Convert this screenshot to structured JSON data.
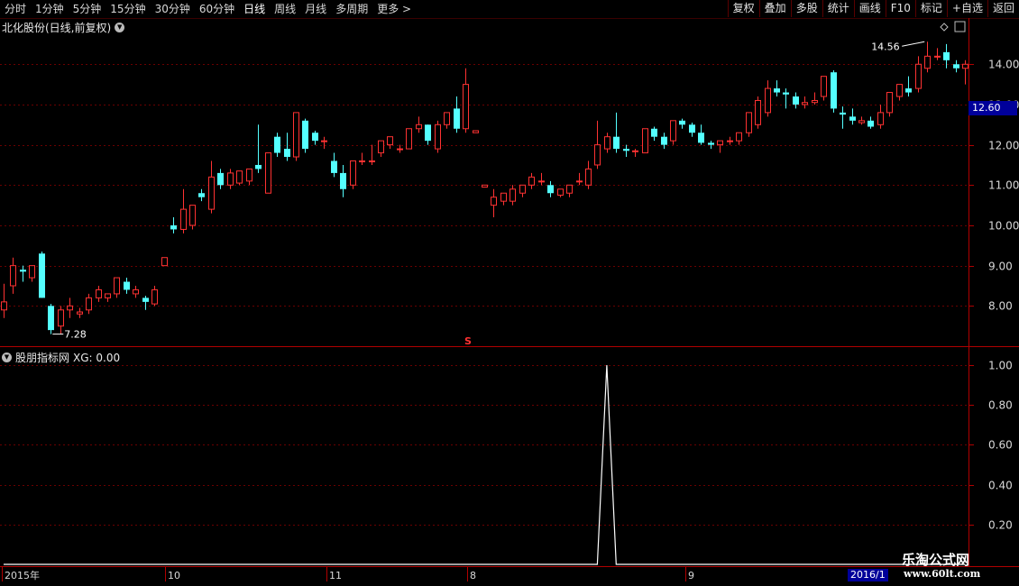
{
  "toolbar": {
    "periods": [
      "分时",
      "1分钟",
      "5分钟",
      "15分钟",
      "30分钟",
      "60分钟",
      "日线",
      "周线",
      "月线",
      "多周期",
      "更多 >"
    ],
    "active_period": "日线",
    "right_buttons": [
      "复权",
      "叠加",
      "多股",
      "统计",
      "画线",
      "F10",
      "标记",
      "+自选",
      "返回"
    ]
  },
  "main_chart": {
    "title": "北化股份(日线,前复权)",
    "high_label": "14.56",
    "low_label": "7.28",
    "current_price": "12.60",
    "marker": "S",
    "up_color": "#ff3232",
    "down_color": "#54ffff",
    "grid_color": "#6a0000"
  },
  "indicator": {
    "title": "股朋指标网",
    "value_text": "XG: 0.00"
  },
  "date_axis": [
    "2015年",
    "10",
    "11",
    "8",
    "9"
  ],
  "date_axis_end": "2016/1",
  "watermark": {
    "title": "乐淘公式网",
    "url": "www.60lt.com"
  },
  "chart_data": [
    {
      "type": "candlestick",
      "y_axis_labels": [
        "14.00",
        "13.00",
        "12.00",
        "11.00",
        "10.00",
        "9.00",
        "8.00"
      ],
      "ylim": [
        7.0,
        14.7
      ],
      "candles": [
        [
          7.9,
          8.55,
          8.1,
          7.7
        ],
        [
          8.5,
          9.2,
          9.0,
          8.3
        ],
        [
          8.9,
          9.0,
          8.85,
          8.6
        ],
        [
          8.7,
          9.0,
          9.0,
          8.6
        ],
        [
          9.3,
          9.35,
          8.2,
          8.2
        ],
        [
          8.0,
          8.05,
          7.4,
          7.3
        ],
        [
          7.5,
          8.0,
          7.9,
          7.3
        ],
        [
          7.9,
          8.2,
          8.0,
          7.7
        ],
        [
          7.8,
          7.95,
          7.85,
          7.7
        ],
        [
          7.9,
          8.3,
          8.2,
          7.8
        ],
        [
          8.2,
          8.5,
          8.4,
          8.1
        ],
        [
          8.2,
          8.3,
          8.3,
          8.1
        ],
        [
          8.3,
          8.7,
          8.7,
          8.2
        ],
        [
          8.6,
          8.7,
          8.4,
          8.3
        ],
        [
          8.3,
          8.5,
          8.4,
          8.2
        ],
        [
          8.2,
          8.25,
          8.1,
          7.9
        ],
        [
          8.05,
          8.5,
          8.4,
          8.0
        ],
        [
          9.0,
          9.2,
          9.2,
          9.0
        ],
        [
          10.0,
          10.2,
          9.9,
          9.8
        ],
        [
          9.9,
          10.9,
          10.4,
          9.8
        ],
        [
          10.0,
          10.5,
          10.5,
          9.9
        ],
        [
          10.8,
          10.9,
          10.7,
          10.6
        ],
        [
          10.4,
          11.6,
          11.2,
          10.3
        ],
        [
          11.3,
          11.4,
          11.0,
          10.9
        ],
        [
          11.0,
          11.4,
          11.3,
          10.9
        ],
        [
          11.05,
          11.3,
          11.35,
          11.0
        ],
        [
          11.1,
          11.4,
          11.4,
          11.0
        ],
        [
          11.5,
          12.5,
          11.4,
          11.3
        ],
        [
          10.8,
          11.8,
          11.8,
          10.8
        ],
        [
          12.2,
          12.3,
          11.8,
          11.7
        ],
        [
          11.9,
          12.3,
          11.7,
          11.6
        ],
        [
          11.7,
          12.8,
          12.8,
          11.6
        ],
        [
          12.6,
          12.65,
          11.9,
          11.8
        ],
        [
          12.3,
          12.35,
          12.1,
          12.0
        ],
        [
          12.1,
          12.2,
          12.1,
          11.9
        ],
        [
          11.6,
          11.8,
          11.3,
          11.2
        ],
        [
          11.3,
          11.5,
          10.9,
          10.7
        ],
        [
          11.0,
          11.6,
          11.6,
          10.9
        ],
        [
          11.6,
          11.8,
          11.6,
          11.5
        ],
        [
          11.6,
          12.0,
          11.6,
          11.5
        ],
        [
          11.8,
          12.1,
          12.1,
          11.7
        ],
        [
          12.0,
          12.2,
          12.2,
          11.9
        ],
        [
          11.9,
          12.0,
          11.9,
          11.8
        ],
        [
          11.9,
          12.3,
          12.4,
          11.9
        ],
        [
          12.4,
          12.7,
          12.5,
          12.3
        ],
        [
          12.5,
          12.5,
          12.1,
          12.0
        ],
        [
          11.9,
          12.6,
          12.5,
          11.8
        ],
        [
          12.5,
          12.8,
          12.8,
          12.4
        ],
        [
          12.9,
          13.2,
          12.4,
          12.3
        ],
        [
          12.4,
          13.9,
          13.5,
          12.3
        ],
        [
          12.3,
          12.35,
          12.35,
          12.3
        ],
        [
          10.95,
          11.0,
          11.0,
          10.95
        ],
        [
          10.5,
          10.9,
          10.7,
          10.2
        ],
        [
          10.6,
          10.8,
          10.8,
          10.5
        ],
        [
          10.6,
          11.0,
          10.9,
          10.5
        ],
        [
          10.8,
          11.0,
          11.0,
          10.7
        ],
        [
          11.0,
          11.3,
          11.2,
          10.9
        ],
        [
          11.1,
          11.3,
          11.1,
          11.0
        ],
        [
          11.0,
          11.1,
          10.8,
          10.7
        ],
        [
          10.75,
          10.9,
          10.9,
          10.7
        ],
        [
          10.8,
          11.0,
          11.0,
          10.7
        ],
        [
          11.1,
          11.3,
          11.1,
          11.0
        ],
        [
          11.0,
          11.6,
          11.4,
          10.9
        ],
        [
          11.5,
          12.6,
          12.0,
          11.4
        ],
        [
          11.9,
          12.3,
          12.2,
          11.8
        ],
        [
          12.2,
          12.8,
          11.9,
          11.8
        ],
        [
          11.9,
          12.0,
          11.85,
          11.7
        ],
        [
          11.85,
          11.9,
          11.85,
          11.7
        ],
        [
          11.8,
          12.4,
          12.4,
          11.8
        ],
        [
          12.4,
          12.45,
          12.2,
          12.1
        ],
        [
          12.2,
          12.3,
          12.0,
          11.9
        ],
        [
          12.1,
          12.5,
          12.6,
          12.0
        ],
        [
          12.6,
          12.65,
          12.5,
          12.4
        ],
        [
          12.5,
          12.55,
          12.3,
          12.2
        ],
        [
          12.3,
          12.5,
          12.05,
          12.0
        ],
        [
          12.05,
          12.1,
          12.0,
          11.9
        ],
        [
          12.0,
          12.1,
          12.1,
          11.8
        ],
        [
          12.1,
          12.2,
          12.1,
          12.0
        ],
        [
          12.1,
          12.3,
          12.3,
          12.0
        ],
        [
          12.3,
          12.8,
          12.8,
          12.2
        ],
        [
          12.5,
          13.2,
          13.1,
          12.4
        ],
        [
          12.8,
          13.6,
          13.4,
          12.7
        ],
        [
          13.4,
          13.6,
          13.3,
          13.2
        ],
        [
          13.3,
          13.4,
          13.25,
          12.9
        ],
        [
          13.2,
          13.3,
          13.0,
          12.9
        ],
        [
          13.0,
          13.2,
          13.05,
          12.9
        ],
        [
          13.05,
          13.3,
          13.1,
          13.0
        ],
        [
          13.2,
          13.7,
          13.7,
          13.1
        ],
        [
          13.8,
          13.85,
          12.9,
          12.8
        ],
        [
          12.8,
          12.95,
          12.75,
          12.4
        ],
        [
          12.7,
          12.9,
          12.6,
          12.5
        ],
        [
          12.55,
          12.7,
          12.6,
          12.5
        ],
        [
          12.6,
          12.7,
          12.45,
          12.4
        ],
        [
          12.5,
          13.0,
          12.8,
          12.4
        ],
        [
          12.8,
          13.3,
          13.3,
          12.7
        ],
        [
          13.2,
          13.5,
          13.5,
          13.1
        ],
        [
          13.4,
          13.7,
          13.3,
          13.2
        ],
        [
          13.4,
          14.2,
          14.0,
          13.3
        ],
        [
          13.9,
          14.56,
          14.2,
          13.8
        ],
        [
          14.2,
          14.4,
          14.2,
          14.1
        ],
        [
          14.3,
          14.5,
          14.1,
          13.9
        ],
        [
          14.0,
          14.1,
          13.9,
          13.8
        ],
        [
          13.9,
          14.1,
          14.0,
          13.5
        ]
      ]
    },
    {
      "type": "line",
      "series": [
        {
          "name": "XG",
          "values": [
            0,
            0,
            0,
            0,
            0,
            0,
            0,
            0,
            0,
            0,
            0,
            0,
            0,
            0,
            0,
            0,
            0,
            0,
            0,
            0,
            0,
            0,
            0,
            0,
            0,
            0,
            0,
            0,
            0,
            0,
            0,
            0,
            0,
            0,
            0,
            0,
            0,
            0,
            0,
            0,
            0,
            0,
            0,
            0,
            0,
            0,
            0,
            0,
            0,
            0,
            0,
            0,
            0,
            0,
            0,
            0,
            0,
            0,
            0,
            0,
            0,
            0,
            0,
            0,
            1,
            0,
            0,
            0,
            0,
            0,
            0,
            0,
            0,
            0,
            0,
            0,
            0,
            0,
            0,
            0,
            0,
            0,
            0,
            0,
            0,
            0,
            0,
            0,
            0,
            0,
            0,
            0,
            0,
            0,
            0,
            0,
            0,
            0,
            0,
            0,
            0,
            0,
            0
          ]
        }
      ],
      "y_axis_labels": [
        "1.00",
        "0.80",
        "0.60",
        "0.40",
        "0.20"
      ],
      "ylim": [
        0,
        1.0
      ]
    }
  ]
}
